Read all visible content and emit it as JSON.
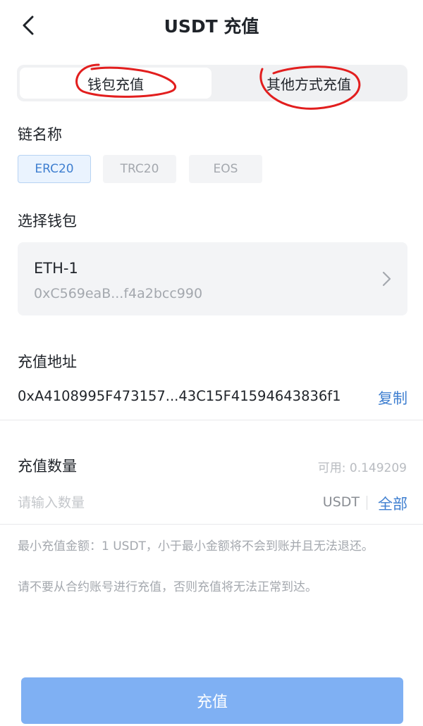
{
  "header": {
    "title": "USDT 充值"
  },
  "tabs": [
    {
      "label": "钱包充值"
    },
    {
      "label": "其他方式充值"
    }
  ],
  "chain": {
    "label": "链名称",
    "options": [
      "ERC20",
      "TRC20",
      "EOS"
    ],
    "selected": "ERC20"
  },
  "wallet": {
    "label": "选择钱包",
    "name": "ETH-1",
    "address": "0xC569eaB...f4a2bcc990"
  },
  "deposit_address": {
    "label": "充值地址",
    "value": "0xA4108995F473157...43C15F41594643836f1",
    "copy_label": "复制"
  },
  "amount": {
    "label": "充值数量",
    "available": "可用: 0.149209",
    "placeholder": "请输入数量",
    "unit": "USDT",
    "all_label": "全部"
  },
  "notes": [
    "最小充值金额：1 USDT，小于最小金额将不会到账并且无法退还。",
    "请不要从合约账号进行充值，否则充值将无法正常到达。"
  ],
  "submit_label": "充值",
  "colors": {
    "accent": "#3f7fd0",
    "button": "#7fb0f3",
    "annotation": "#e21e1e"
  }
}
